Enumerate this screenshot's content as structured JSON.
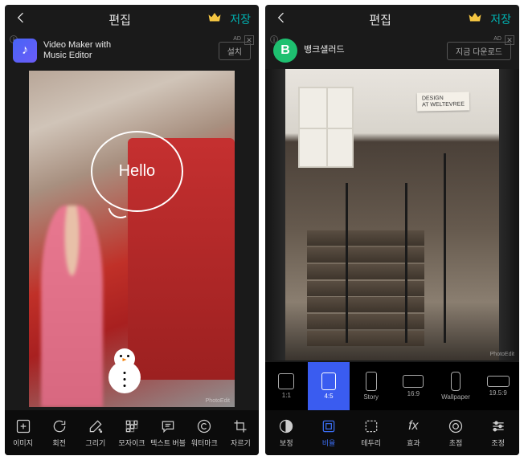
{
  "left": {
    "header": {
      "title": "편집",
      "save": "저장"
    },
    "ad": {
      "label": "AD",
      "title_line1": "Video Maker with",
      "title_line2": "Music Editor",
      "cta": "설치"
    },
    "overlay_text": "Hello",
    "watermark": "PhotoEdit",
    "tools": [
      {
        "key": "image",
        "label": "이미지"
      },
      {
        "key": "rotate",
        "label": "회전"
      },
      {
        "key": "draw",
        "label": "그리기"
      },
      {
        "key": "mosaic",
        "label": "모자이크"
      },
      {
        "key": "bubble",
        "label": "텍스트 버블"
      },
      {
        "key": "wmark",
        "label": "워터마크"
      },
      {
        "key": "crop",
        "label": "자르기"
      }
    ]
  },
  "right": {
    "header": {
      "title": "편집",
      "save": "저장"
    },
    "ad": {
      "label": "AD",
      "title": "뱅크샐러드",
      "cta": "지금 다운로드"
    },
    "sign_line1": "DESIGN",
    "sign_line2": "AT WELTEVREE",
    "watermark": "PhotoEdit",
    "ratios": [
      {
        "key": "r11",
        "label": "1:1"
      },
      {
        "key": "r45",
        "label": "4:5",
        "active": true
      },
      {
        "key": "story",
        "label": "Story"
      },
      {
        "key": "r169",
        "label": "16:9"
      },
      {
        "key": "wall",
        "label": "Wallpaper"
      },
      {
        "key": "r195",
        "label": "19.5:9"
      }
    ],
    "tools": [
      {
        "key": "adjust",
        "label": "보정"
      },
      {
        "key": "ratio",
        "label": "비율",
        "active": true
      },
      {
        "key": "border",
        "label": "테두리"
      },
      {
        "key": "fx",
        "label": "효과"
      },
      {
        "key": "focus",
        "label": "초점"
      },
      {
        "key": "tune",
        "label": "조정"
      }
    ]
  }
}
